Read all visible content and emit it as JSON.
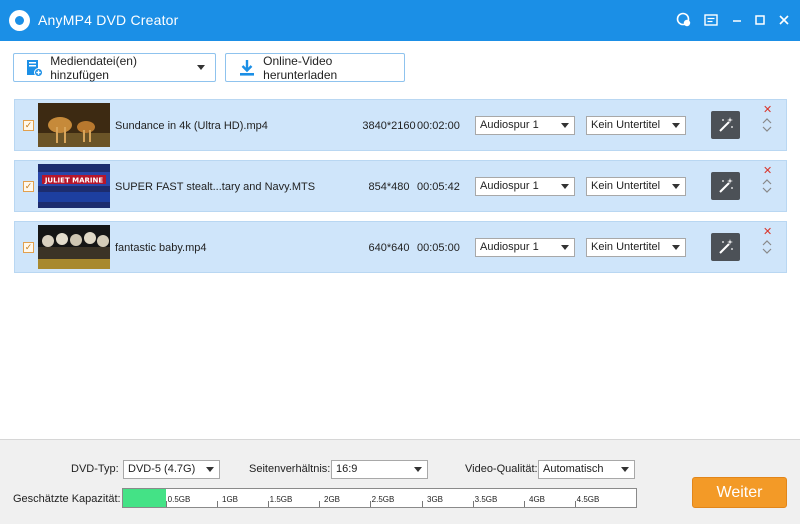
{
  "app": {
    "title": "AnyMP4 DVD Creator"
  },
  "toolbar": {
    "add_media_label": "Mediendatei(en) hinzufügen",
    "download_label": "Online-Video herunterladen"
  },
  "files": [
    {
      "name": "Sundance in 4k (Ultra HD).mp4",
      "resolution": "3840*2160",
      "duration": "00:02:00",
      "audio": "Audiospur 1",
      "subtitle": "Kein Untertitel",
      "thumb_text": ""
    },
    {
      "name": "SUPER FAST stealt...tary and Navy.MTS",
      "resolution": "854*480",
      "duration": "00:05:42",
      "audio": "Audiospur 1",
      "subtitle": "Kein Untertitel",
      "thumb_text": "JULIET MARINE"
    },
    {
      "name": "fantastic baby.mp4",
      "resolution": "640*640",
      "duration": "00:05:00",
      "audio": "Audiospur 1",
      "subtitle": "Kein Untertitel",
      "thumb_text": ""
    }
  ],
  "bottom": {
    "dvd_type_label": "DVD-Typ:",
    "dvd_type_value": "DVD-5 (4.7G)",
    "aspect_label": "Seitenverhältnis:",
    "aspect_value": "16:9",
    "quality_label": "Video-Qualität:",
    "quality_value": "Automatisch",
    "capacity_label": "Geschätzte Kapazität:",
    "capacity_used_fraction": 0.084,
    "capacity_ticks": [
      "0.5GB",
      "1GB",
      "1.5GB",
      "2GB",
      "2.5GB",
      "3GB",
      "3.5GB",
      "4GB",
      "4.5GB"
    ],
    "next_label": "Weiter"
  },
  "colors": {
    "accent": "#1b8fe6",
    "row_bg": "#cfe5fa",
    "capacity_fill": "#44e286",
    "next_button": "#f39a27"
  }
}
